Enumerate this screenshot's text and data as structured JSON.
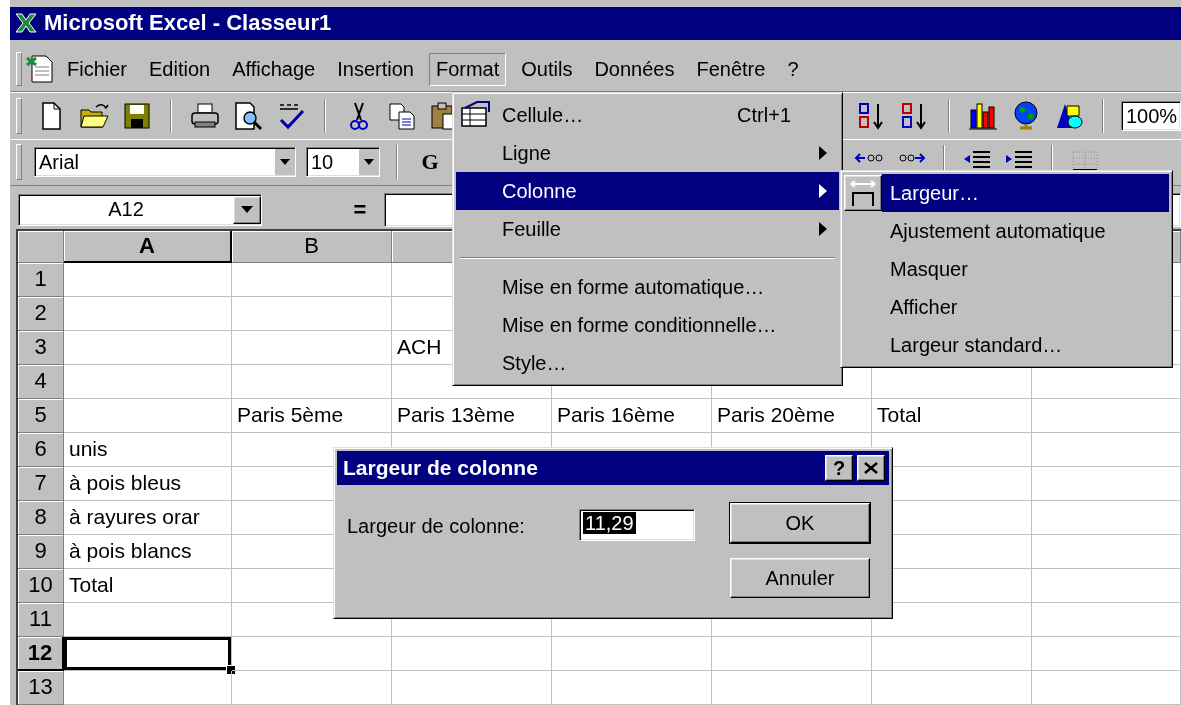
{
  "window": {
    "title": "Microsoft Excel - Classeur1"
  },
  "menu_bar": [
    {
      "label": "Fichier",
      "selected": false
    },
    {
      "label": "Edition",
      "selected": false
    },
    {
      "label": "Affichage",
      "selected": false
    },
    {
      "label": "Insertion",
      "selected": false
    },
    {
      "label": "Format",
      "selected": true
    },
    {
      "label": "Outils",
      "selected": false
    },
    {
      "label": "Données",
      "selected": false
    },
    {
      "label": "Fenêtre",
      "selected": false
    },
    {
      "label": "?",
      "selected": false
    }
  ],
  "standard_toolbar": {
    "zoom": "100%"
  },
  "formatting_toolbar": {
    "font": "Arial",
    "font_size": "10",
    "bold": "G"
  },
  "formula_bar": {
    "name_box": "A12",
    "equals": "="
  },
  "sheet": {
    "columns": [
      {
        "label": "A",
        "selected": true
      },
      {
        "label": "B",
        "selected": false
      }
    ],
    "rows": [
      {
        "label": "1",
        "selected": false
      },
      {
        "label": "2",
        "selected": false
      },
      {
        "label": "3",
        "selected": false,
        "cells": [
          null,
          null,
          "ACH"
        ]
      },
      {
        "label": "4",
        "selected": false
      },
      {
        "label": "5",
        "selected": false,
        "cells": [
          null,
          "Paris 5ème",
          "Paris 13ème",
          "Paris 16ème",
          "Paris 20ème",
          "Total"
        ]
      },
      {
        "label": "6",
        "selected": false,
        "cells": [
          "unis"
        ]
      },
      {
        "label": "7",
        "selected": false,
        "cells": [
          "à pois bleus"
        ]
      },
      {
        "label": "8",
        "selected": false,
        "cells": [
          "à rayures orar"
        ]
      },
      {
        "label": "9",
        "selected": false,
        "cells": [
          "à pois blancs"
        ]
      },
      {
        "label": "10",
        "selected": false,
        "cells": [
          "Total"
        ]
      },
      {
        "label": "11",
        "selected": false
      },
      {
        "label": "12",
        "selected": true
      },
      {
        "label": "13",
        "selected": false
      }
    ]
  },
  "format_menu": {
    "items": [
      {
        "kind": "command",
        "label": "Cellule…",
        "shortcut": "Ctrl+1",
        "has_icon": true,
        "selected": false
      },
      {
        "kind": "submenu",
        "label": "Ligne",
        "has_icon": false,
        "selected": false
      },
      {
        "kind": "submenu",
        "label": "Colonne",
        "has_icon": false,
        "selected": true
      },
      {
        "kind": "submenu",
        "label": "Feuille",
        "has_icon": false,
        "selected": false
      },
      {
        "kind": "separator"
      },
      {
        "kind": "command",
        "label": "Mise en forme automatique…",
        "has_icon": false,
        "selected": false
      },
      {
        "kind": "command",
        "label": "Mise en forme conditionnelle…",
        "has_icon": false,
        "selected": false
      },
      {
        "kind": "command",
        "label": "Style…",
        "has_icon": false,
        "selected": false
      }
    ]
  },
  "column_submenu": {
    "items": [
      {
        "kind": "command",
        "label": "Largeur…",
        "has_icon": true,
        "selected": true
      },
      {
        "kind": "command",
        "label": "Ajustement automatique",
        "has_icon": false,
        "selected": false
      },
      {
        "kind": "command",
        "label": "Masquer",
        "has_icon": false,
        "selected": false
      },
      {
        "kind": "command",
        "label": "Afficher",
        "has_icon": false,
        "selected": false
      },
      {
        "kind": "command",
        "label": "Largeur standard…",
        "has_icon": false,
        "selected": false
      }
    ]
  },
  "dialog": {
    "title": "Largeur de colonne",
    "help": "?",
    "field_label": "Largeur de colonne:",
    "value": "11,29",
    "value_selected": true,
    "buttons": [
      {
        "label": "OK",
        "default": true
      },
      {
        "label": "Annuler",
        "default": false
      }
    ]
  }
}
